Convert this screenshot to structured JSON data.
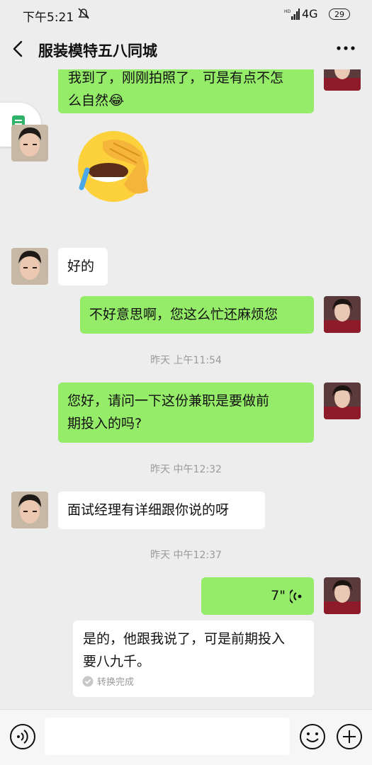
{
  "status_bar": {
    "time": "下午5:21",
    "network": "4G",
    "battery": "29"
  },
  "nav": {
    "title": "服装模特五八同城"
  },
  "messages": [
    {
      "line1": "我到了，刚刚拍照了，可是有点不怎",
      "line2": "么自然😂"
    },
    {
      "text": "好的"
    },
    {
      "text": "不好意思啊，您这么忙还麻烦您"
    },
    {
      "line1": "您好，请问一下这份兼职是要做前",
      "line2": "期投入的吗?"
    },
    {
      "text": "面试经理有详细跟你说的呀"
    },
    {
      "duration": "7\""
    }
  ],
  "timestamps": [
    "昨天 上午11:54",
    "昨天 中午12:32",
    "昨天 中午12:37"
  ],
  "transcript": {
    "line1": "是的，他跟我说了，可是前期投入",
    "line2": "要八九千。",
    "status": "转换完成"
  },
  "colors": {
    "outgoing_bubble": "#95ec69",
    "incoming_bubble": "#ffffff",
    "background": "#ededed"
  },
  "icons": [
    "back-icon",
    "more-icon",
    "voice-toggle-icon",
    "emoji-icon",
    "plus-icon",
    "document-icon",
    "voice-wave-icon"
  ]
}
